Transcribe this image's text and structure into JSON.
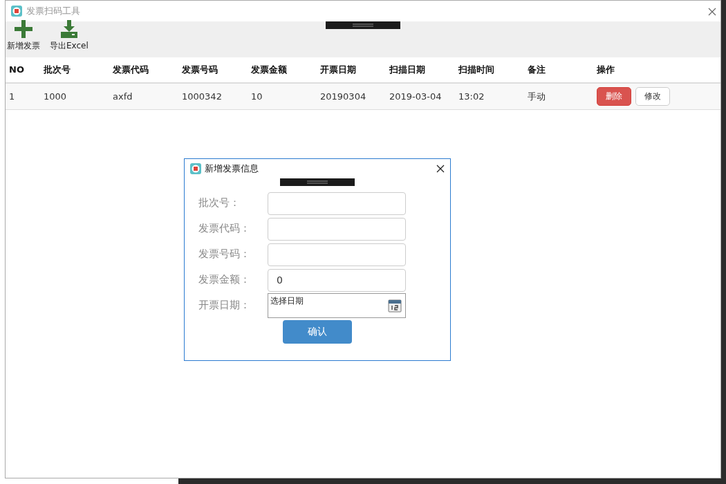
{
  "window": {
    "title": "发票扫码工具"
  },
  "toolbar": [
    {
      "label": "新增发票",
      "kind": "add"
    },
    {
      "label": "导出Excel",
      "kind": "export"
    }
  ],
  "table": {
    "columns": [
      "NO",
      "批次号",
      "发票代码",
      "发票号码",
      "发票金额",
      "开票日期",
      "扫描日期",
      "扫描时间",
      "备注",
      "操作"
    ],
    "rows": [
      {
        "cells": [
          "1",
          "1000",
          "axfd",
          "1000342",
          "10",
          "20190304",
          "2019-03-04",
          "13:02",
          "手动"
        ],
        "actions": [
          {
            "label": "删除",
            "kind": "danger"
          },
          {
            "label": "修改",
            "kind": "default"
          }
        ]
      }
    ]
  },
  "dialog": {
    "title": "新增发票信息",
    "fields": [
      {
        "label": "批次号：",
        "kind": "text"
      },
      {
        "label": "发票代码：",
        "kind": "text"
      },
      {
        "label": "发票号码：",
        "kind": "text"
      },
      {
        "label": "发票金额：",
        "kind": "text",
        "value": "0"
      },
      {
        "label": "开票日期：",
        "kind": "date",
        "placeholder": "选择日期"
      }
    ],
    "confirm": "确认"
  }
}
